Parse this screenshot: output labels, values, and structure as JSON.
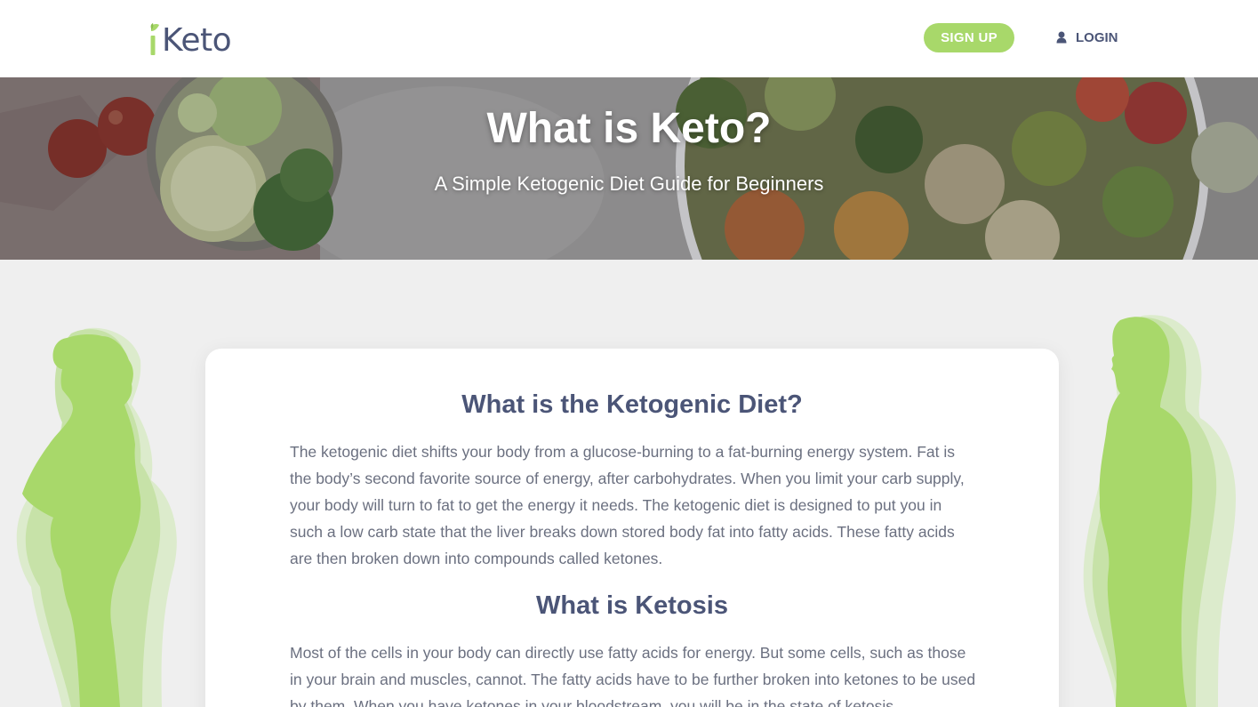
{
  "header": {
    "logo_text": "Keto",
    "logo_icon": "leaf-i-icon",
    "signup_label": "SIGN UP",
    "login_label": "LOGIN",
    "login_icon": "user-icon"
  },
  "hero": {
    "title": "What is Keto?",
    "subtitle": "A Simple Ketogenic Diet Guide for Beginners"
  },
  "article": {
    "heading_1": "What is the Ketogenic Diet?",
    "paragraph_1": "The ketogenic diet shifts your body from a glucose-burning to a fat-burning energy system. Fat is the body’s second favorite source of energy, after carbohydrates. When you limit your carb supply, your body will turn to fat to get the energy it needs. The ketogenic diet is designed to put you in such a low carb state that the liver breaks down stored body fat into fatty acids. These fatty acids are then broken down into compounds called ketones.",
    "heading_2": "What is Ketosis",
    "paragraph_2": "Most of the cells in your body can directly use fatty acids for energy. But some cells, such as those in your brain and muscles, cannot. The fatty acids have to be further broken into ketones to be used by them. When you have ketones in your bloodstream, you will be in the state of ketosis."
  },
  "colors": {
    "brand_green": "#a8d86a",
    "brand_navy": "#4b5577",
    "page_bg": "#efefef",
    "body_text": "#6b7080"
  }
}
